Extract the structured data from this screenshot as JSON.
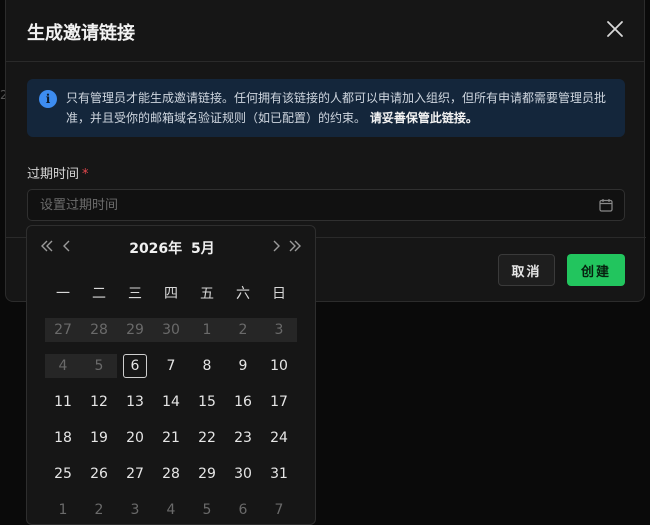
{
  "background": {
    "partial_text": "2"
  },
  "modal": {
    "title": "生成邀请链接",
    "info_text": "只有管理员才能生成邀请链接。任何拥有该链接的人都可以申请加入组织，但所有申请都需要管理员批准，并且受你的邮箱域名验证规则（如已配置）的约束。",
    "info_emphasis": "请妥善保管此链接。",
    "field_label": "过期时间",
    "required_mark": "*",
    "placeholder": "设置过期时间",
    "cancel_label": "取消",
    "create_label": "创建"
  },
  "picker": {
    "year": "2026年",
    "month": "5月",
    "weekdays": [
      "一",
      "二",
      "三",
      "四",
      "五",
      "六",
      "日"
    ],
    "weeks": [
      [
        {
          "d": "27",
          "s": "disabled"
        },
        {
          "d": "28",
          "s": "disabled"
        },
        {
          "d": "29",
          "s": "disabled"
        },
        {
          "d": "30",
          "s": "disabled"
        },
        {
          "d": "1",
          "s": "disabled"
        },
        {
          "d": "2",
          "s": "disabled"
        },
        {
          "d": "3",
          "s": "disabled"
        }
      ],
      [
        {
          "d": "4",
          "s": "disabled"
        },
        {
          "d": "5",
          "s": "disabled"
        },
        {
          "d": "6",
          "s": "today"
        },
        {
          "d": "7",
          "s": ""
        },
        {
          "d": "8",
          "s": ""
        },
        {
          "d": "9",
          "s": ""
        },
        {
          "d": "10",
          "s": ""
        }
      ],
      [
        {
          "d": "11",
          "s": ""
        },
        {
          "d": "12",
          "s": ""
        },
        {
          "d": "13",
          "s": ""
        },
        {
          "d": "14",
          "s": ""
        },
        {
          "d": "15",
          "s": ""
        },
        {
          "d": "16",
          "s": ""
        },
        {
          "d": "17",
          "s": ""
        }
      ],
      [
        {
          "d": "18",
          "s": ""
        },
        {
          "d": "19",
          "s": ""
        },
        {
          "d": "20",
          "s": ""
        },
        {
          "d": "21",
          "s": ""
        },
        {
          "d": "22",
          "s": ""
        },
        {
          "d": "23",
          "s": ""
        },
        {
          "d": "24",
          "s": ""
        }
      ],
      [
        {
          "d": "25",
          "s": ""
        },
        {
          "d": "26",
          "s": ""
        },
        {
          "d": "27",
          "s": ""
        },
        {
          "d": "28",
          "s": ""
        },
        {
          "d": "29",
          "s": ""
        },
        {
          "d": "30",
          "s": ""
        },
        {
          "d": "31",
          "s": ""
        }
      ],
      [
        {
          "d": "1",
          "s": "muted"
        },
        {
          "d": "2",
          "s": "muted"
        },
        {
          "d": "3",
          "s": "muted"
        },
        {
          "d": "4",
          "s": "muted"
        },
        {
          "d": "5",
          "s": "muted"
        },
        {
          "d": "6",
          "s": "muted"
        },
        {
          "d": "7",
          "s": "muted"
        }
      ]
    ]
  }
}
